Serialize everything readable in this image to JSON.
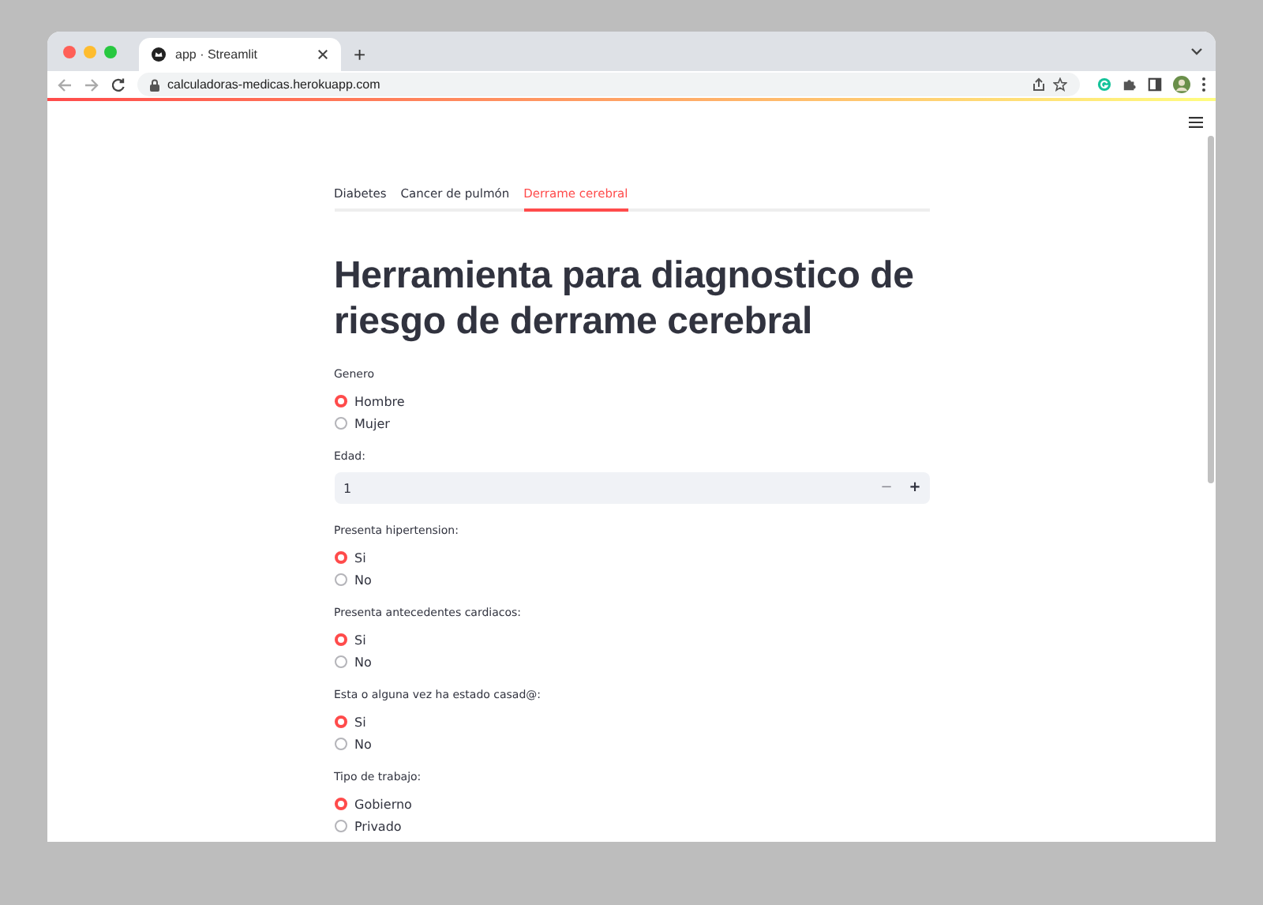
{
  "browser": {
    "tab_title": "app · Streamlit",
    "new_tab": "+",
    "url": "calculadoras-medicas.herokuapp.com"
  },
  "app": {
    "tabs": [
      {
        "label": "Diabetes",
        "selected": false
      },
      {
        "label": "Cancer de pulmón",
        "selected": false
      },
      {
        "label": "Derrame cerebral",
        "selected": true
      }
    ],
    "title": "Herramienta para diagnostico de riesgo de derrame cerebral",
    "fields": [
      {
        "kind": "radio",
        "label": "Genero",
        "options": [
          {
            "label": "Hombre",
            "selected": true
          },
          {
            "label": "Mujer",
            "selected": false
          }
        ]
      },
      {
        "kind": "number",
        "label": "Edad:",
        "value": "1",
        "decrement": "−",
        "increment": "+"
      },
      {
        "kind": "radio",
        "label": "Presenta hipertension:",
        "options": [
          {
            "label": "Si",
            "selected": true
          },
          {
            "label": "No",
            "selected": false
          }
        ]
      },
      {
        "kind": "radio",
        "label": "Presenta antecedentes cardiacos:",
        "options": [
          {
            "label": "Si",
            "selected": true
          },
          {
            "label": "No",
            "selected": false
          }
        ]
      },
      {
        "kind": "radio",
        "label": "Esta o alguna vez ha estado casad@:",
        "options": [
          {
            "label": "Si",
            "selected": true
          },
          {
            "label": "No",
            "selected": false
          }
        ]
      },
      {
        "kind": "radio",
        "label": "Tipo de trabajo:",
        "options": [
          {
            "label": "Gobierno",
            "selected": true
          },
          {
            "label": "Privado",
            "selected": false
          }
        ]
      }
    ]
  }
}
